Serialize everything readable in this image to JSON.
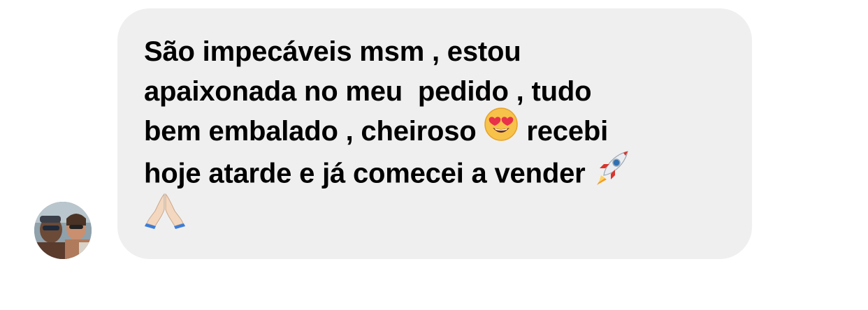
{
  "message": {
    "sender": "incoming",
    "lines": [
      "São impecáveis msm , estou",
      "apaixonada no meu  pedido , tudo",
      "bem embalado , cheiroso ",
      " recebi",
      "hoje atarde e já comecei a vender ",
      ""
    ],
    "emojis": [
      "heart-eyes-emoji",
      "rocket-emoji",
      "folded-hands-emoji"
    ]
  },
  "colors": {
    "bubble_bg": "#efefef",
    "text": "#000000",
    "background": "#ffffff"
  }
}
